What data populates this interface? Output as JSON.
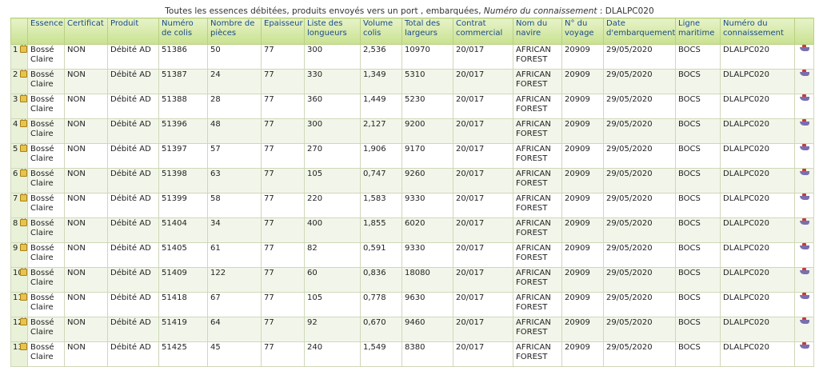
{
  "caption": {
    "text": "Toutes les essences débitées, produits envoyés vers un port , embarquées, ",
    "label": "Numéro du connaissement",
    "value": " : DLALPC020"
  },
  "columns": [
    {
      "key": "essence",
      "label": "Essence"
    },
    {
      "key": "certificat",
      "label": "Certificat"
    },
    {
      "key": "produit",
      "label": "Produit"
    },
    {
      "key": "numero_colis",
      "label": "Numéro de colis"
    },
    {
      "key": "nombre_pieces",
      "label": "Nombre de pièces"
    },
    {
      "key": "epaisseur",
      "label": "Epaisseur"
    },
    {
      "key": "longueurs",
      "label": "Liste des longueurs"
    },
    {
      "key": "volume",
      "label": "Volume colis"
    },
    {
      "key": "largeurs",
      "label": "Total des largeurs"
    },
    {
      "key": "contrat",
      "label": "Contrat commercial"
    },
    {
      "key": "navire",
      "label": "Nom du navire"
    },
    {
      "key": "voyage",
      "label": "N° du voyage"
    },
    {
      "key": "date",
      "label": "Date d'embarquement"
    },
    {
      "key": "ligne",
      "label": "Ligne maritime"
    },
    {
      "key": "connaissement",
      "label": "Numéro du connaissement"
    }
  ],
  "rows": [
    {
      "n": "1",
      "essence": "Bossé Claire",
      "certificat": "NON",
      "produit": "Débité AD",
      "numero_colis": "51386",
      "nombre_pieces": "50",
      "epaisseur": "77",
      "longueurs": "300",
      "volume": "2,536",
      "largeurs": "10970",
      "contrat": "20/017",
      "navire": "AFRICAN FOREST",
      "voyage": "20909",
      "date": "29/05/2020",
      "ligne": "BOCS",
      "connaissement": "DLALPC020"
    },
    {
      "n": "2",
      "essence": "Bossé Claire",
      "certificat": "NON",
      "produit": "Débité AD",
      "numero_colis": "51387",
      "nombre_pieces": "24",
      "epaisseur": "77",
      "longueurs": "330",
      "volume": "1,349",
      "largeurs": "5310",
      "contrat": "20/017",
      "navire": "AFRICAN FOREST",
      "voyage": "20909",
      "date": "29/05/2020",
      "ligne": "BOCS",
      "connaissement": "DLALPC020"
    },
    {
      "n": "3",
      "essence": "Bossé Claire",
      "certificat": "NON",
      "produit": "Débité AD",
      "numero_colis": "51388",
      "nombre_pieces": "28",
      "epaisseur": "77",
      "longueurs": "360",
      "volume": "1,449",
      "largeurs": "5230",
      "contrat": "20/017",
      "navire": "AFRICAN FOREST",
      "voyage": "20909",
      "date": "29/05/2020",
      "ligne": "BOCS",
      "connaissement": "DLALPC020"
    },
    {
      "n": "4",
      "essence": "Bossé Claire",
      "certificat": "NON",
      "produit": "Débité AD",
      "numero_colis": "51396",
      "nombre_pieces": "48",
      "epaisseur": "77",
      "longueurs": "300",
      "volume": "2,127",
      "largeurs": "9200",
      "contrat": "20/017",
      "navire": "AFRICAN FOREST",
      "voyage": "20909",
      "date": "29/05/2020",
      "ligne": "BOCS",
      "connaissement": "DLALPC020"
    },
    {
      "n": "5",
      "essence": "Bossé Claire",
      "certificat": "NON",
      "produit": "Débité AD",
      "numero_colis": "51397",
      "nombre_pieces": "57",
      "epaisseur": "77",
      "longueurs": "270",
      "volume": "1,906",
      "largeurs": "9170",
      "contrat": "20/017",
      "navire": "AFRICAN FOREST",
      "voyage": "20909",
      "date": "29/05/2020",
      "ligne": "BOCS",
      "connaissement": "DLALPC020"
    },
    {
      "n": "6",
      "essence": "Bossé Claire",
      "certificat": "NON",
      "produit": "Débité AD",
      "numero_colis": "51398",
      "nombre_pieces": "63",
      "epaisseur": "77",
      "longueurs": "105",
      "volume": "0,747",
      "largeurs": "9260",
      "contrat": "20/017",
      "navire": "AFRICAN FOREST",
      "voyage": "20909",
      "date": "29/05/2020",
      "ligne": "BOCS",
      "connaissement": "DLALPC020"
    },
    {
      "n": "7",
      "essence": "Bossé Claire",
      "certificat": "NON",
      "produit": "Débité AD",
      "numero_colis": "51399",
      "nombre_pieces": "58",
      "epaisseur": "77",
      "longueurs": "220",
      "volume": "1,583",
      "largeurs": "9330",
      "contrat": "20/017",
      "navire": "AFRICAN FOREST",
      "voyage": "20909",
      "date": "29/05/2020",
      "ligne": "BOCS",
      "connaissement": "DLALPC020"
    },
    {
      "n": "8",
      "essence": "Bossé Claire",
      "certificat": "NON",
      "produit": "Débité AD",
      "numero_colis": "51404",
      "nombre_pieces": "34",
      "epaisseur": "77",
      "longueurs": "400",
      "volume": "1,855",
      "largeurs": "6020",
      "contrat": "20/017",
      "navire": "AFRICAN FOREST",
      "voyage": "20909",
      "date": "29/05/2020",
      "ligne": "BOCS",
      "connaissement": "DLALPC020"
    },
    {
      "n": "9",
      "essence": "Bossé Claire",
      "certificat": "NON",
      "produit": "Débité AD",
      "numero_colis": "51405",
      "nombre_pieces": "61",
      "epaisseur": "77",
      "longueurs": "82",
      "volume": "0,591",
      "largeurs": "9330",
      "contrat": "20/017",
      "navire": "AFRICAN FOREST",
      "voyage": "20909",
      "date": "29/05/2020",
      "ligne": "BOCS",
      "connaissement": "DLALPC020"
    },
    {
      "n": "10",
      "essence": "Bossé Claire",
      "certificat": "NON",
      "produit": "Débité AD",
      "numero_colis": "51409",
      "nombre_pieces": "122",
      "epaisseur": "77",
      "longueurs": "60",
      "volume": "0,836",
      "largeurs": "18080",
      "contrat": "20/017",
      "navire": "AFRICAN FOREST",
      "voyage": "20909",
      "date": "29/05/2020",
      "ligne": "BOCS",
      "connaissement": "DLALPC020"
    },
    {
      "n": "11",
      "essence": "Bossé Claire",
      "certificat": "NON",
      "produit": "Débité AD",
      "numero_colis": "51418",
      "nombre_pieces": "67",
      "epaisseur": "77",
      "longueurs": "105",
      "volume": "0,778",
      "largeurs": "9630",
      "contrat": "20/017",
      "navire": "AFRICAN FOREST",
      "voyage": "20909",
      "date": "29/05/2020",
      "ligne": "BOCS",
      "connaissement": "DLALPC020"
    },
    {
      "n": "12",
      "essence": "Bossé Claire",
      "certificat": "NON",
      "produit": "Débité AD",
      "numero_colis": "51419",
      "nombre_pieces": "64",
      "epaisseur": "77",
      "longueurs": "92",
      "volume": "0,670",
      "largeurs": "9460",
      "contrat": "20/017",
      "navire": "AFRICAN FOREST",
      "voyage": "20909",
      "date": "29/05/2020",
      "ligne": "BOCS",
      "connaissement": "DLALPC020"
    },
    {
      "n": "13",
      "essence": "Bossé Claire",
      "certificat": "NON",
      "produit": "Débité AD",
      "numero_colis": "51425",
      "nombre_pieces": "45",
      "epaisseur": "77",
      "longueurs": "240",
      "volume": "1,549",
      "largeurs": "8380",
      "contrat": "20/017",
      "navire": "AFRICAN FOREST",
      "voyage": "20909",
      "date": "29/05/2020",
      "ligne": "BOCS",
      "connaissement": "DLALPC020"
    }
  ],
  "icons": {
    "row_lock": "lock-icon",
    "row_action": "ship-icon"
  },
  "colors": {
    "header_gradient_top": "#e7f3c9",
    "header_gradient_bottom": "#c9e190",
    "header_text": "#1a4a8a",
    "alt_row": "#f2f6ea"
  }
}
